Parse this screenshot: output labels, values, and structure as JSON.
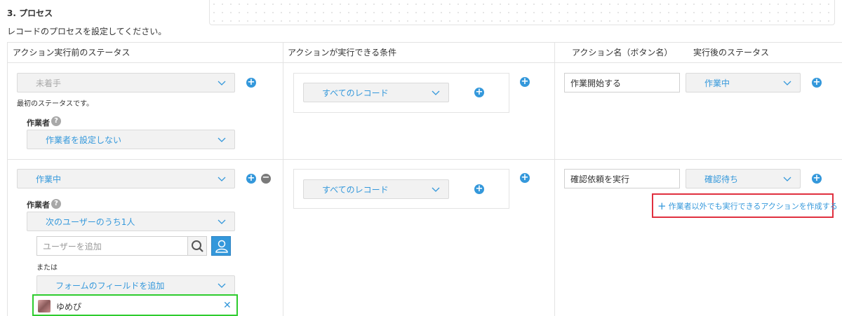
{
  "section": {
    "title": "3. プロセス",
    "description": "レコードのプロセスを設定してください。"
  },
  "headers": {
    "status_before": "アクション実行前のステータス",
    "condition": "アクションが実行できる条件",
    "action_name": "アクション名（ボタン名）",
    "status_after": "実行後のステータス"
  },
  "rows": [
    {
      "status": "未着手",
      "status_note": "最初のステータスです。",
      "assignee_label": "作業者",
      "assignee_select": "作業者を設定しない",
      "condition": "すべてのレコード",
      "action_name": "作業開始する",
      "next_status": "作業中"
    },
    {
      "status": "作業中",
      "assignee_label": "作業者",
      "assignee_select": "次のユーザーのうち1人",
      "user_input_placeholder": "ユーザーを追加",
      "or_label": "または",
      "field_select": "フォームのフィールドを追加",
      "assigned_user": "ゆめぴ",
      "condition": "すべてのレコード",
      "action_name": "確認依頼を実行",
      "next_status": "確認待ち",
      "create_other_action_link": "作業者以外でも実行できるアクションを作成する"
    }
  ],
  "glyphs": {
    "plus": "+",
    "minus": "−",
    "help": "?",
    "close": "✕"
  },
  "colors": {
    "accent": "#3498db",
    "highlight_red": "#e0303f",
    "highlight_green": "#2ecc2e"
  }
}
